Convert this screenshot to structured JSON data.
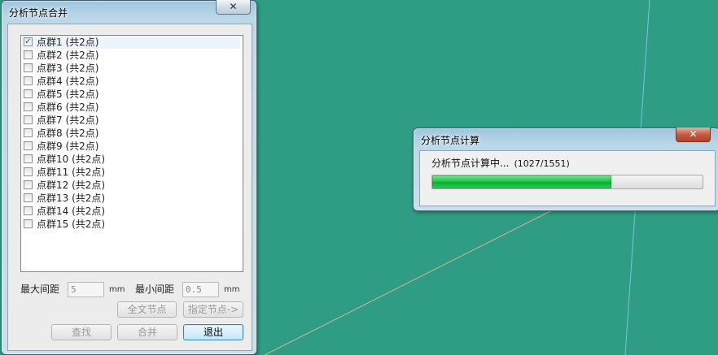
{
  "merge_dialog": {
    "title": "分析节点合并",
    "close_label": "✕",
    "list_items": [
      {
        "label": "点群1 (共2点)",
        "checked": true
      },
      {
        "label": "点群2 (共2点)",
        "checked": false
      },
      {
        "label": "点群3 (共2点)",
        "checked": false
      },
      {
        "label": "点群4 (共2点)",
        "checked": false
      },
      {
        "label": "点群5 (共2点)",
        "checked": false
      },
      {
        "label": "点群6 (共2点)",
        "checked": false
      },
      {
        "label": "点群7 (共2点)",
        "checked": false
      },
      {
        "label": "点群8 (共2点)",
        "checked": false
      },
      {
        "label": "点群9 (共2点)",
        "checked": false
      },
      {
        "label": "点群10 (共2点)",
        "checked": false
      },
      {
        "label": "点群11 (共2点)",
        "checked": false
      },
      {
        "label": "点群12 (共2点)",
        "checked": false
      },
      {
        "label": "点群13 (共2点)",
        "checked": false
      },
      {
        "label": "点群14 (共2点)",
        "checked": false
      },
      {
        "label": "点群15 (共2点)",
        "checked": false
      }
    ],
    "max_spacing_label": "最大间距",
    "max_spacing_value": "5",
    "min_spacing_label": "最小间距",
    "min_spacing_value": "0.5",
    "unit_mm": "mm",
    "buttons": {
      "full_text_nodes": "全文节点",
      "specify_nodes": "指定节点->",
      "find": "查找",
      "merge": "合并",
      "exit": "退出"
    }
  },
  "progress_dialog": {
    "title": "分析节点计算",
    "close_label": "✕",
    "status_text": "分析节点计算中...",
    "count_text": "(1027/1551)",
    "progress_fraction": 0.6622
  }
}
